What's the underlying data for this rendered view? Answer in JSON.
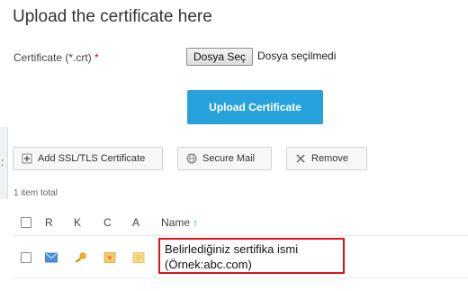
{
  "page": {
    "title": "Upload the certificate here"
  },
  "form": {
    "certificate_label": "Certificate (*.crt)",
    "required_mark": "*",
    "choose_file_label": "Dosya Seç",
    "file_status": "Dosya seçilmedi",
    "upload_label": "Upload Certificate"
  },
  "toolbar": {
    "add_label": "Add SSL/TLS Certificate",
    "secure_mail_label": "Secure Mail",
    "remove_label": "Remove"
  },
  "side_tab": {
    "label": ":"
  },
  "list": {
    "total_text": "1 item total",
    "columns": [
      "R",
      "K",
      "C",
      "A",
      "Name"
    ],
    "sort_indicator": "↑",
    "rows": [
      {
        "name_line1": "Belirlediğiniz sertifika ismi",
        "name_line2": "(Örnek:abc.com)"
      }
    ]
  },
  "colors": {
    "accent": "#27a2dc",
    "highlight_border": "#e0131b",
    "required": "#dd0000"
  },
  "icons": [
    "plus-icon",
    "globe-icon",
    "close-icon",
    "envelope-icon",
    "key-icon",
    "certificate-icon",
    "document-icon",
    "sort-up-icon"
  ]
}
